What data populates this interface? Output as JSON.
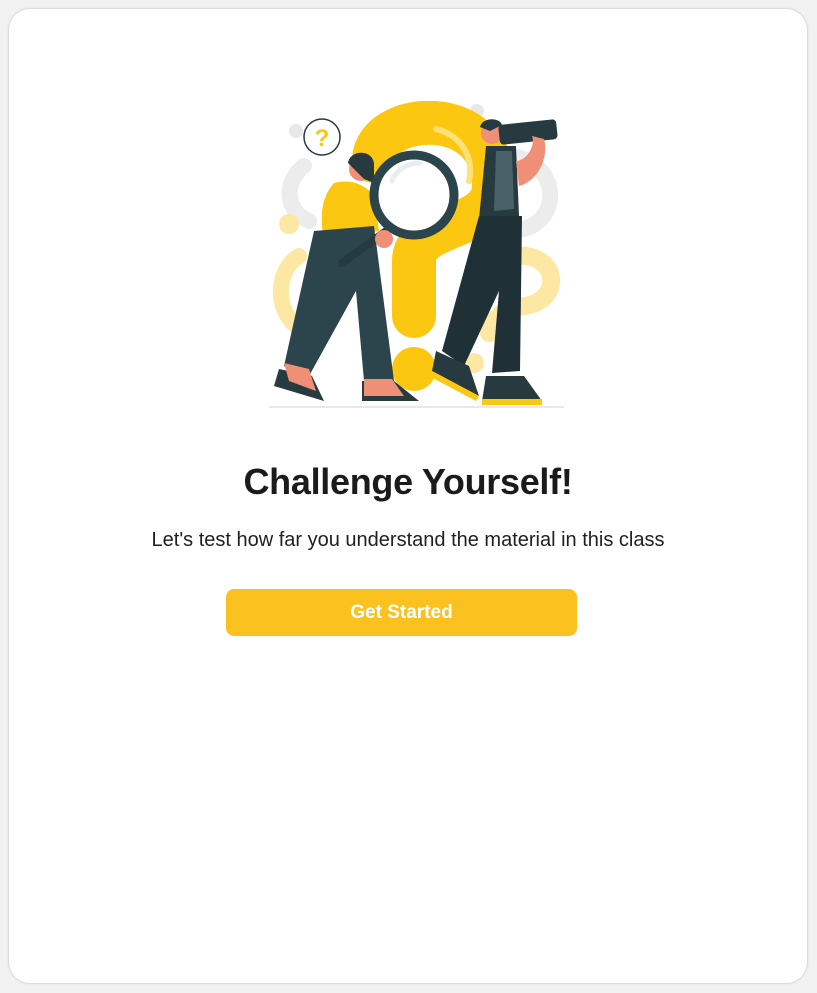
{
  "intro": {
    "title": "Challenge Yourself!",
    "subtitle": "Let's test how far you understand the material in this class",
    "button_label": "Get Started",
    "illustration_question_mark": "?"
  },
  "colors": {
    "accent": "#fbc21f",
    "title_text": "#1b1b1b",
    "illustration_yellow": "#fcc710",
    "illustration_light_yellow": "#fde8a3",
    "illustration_dark": "#263a40"
  }
}
